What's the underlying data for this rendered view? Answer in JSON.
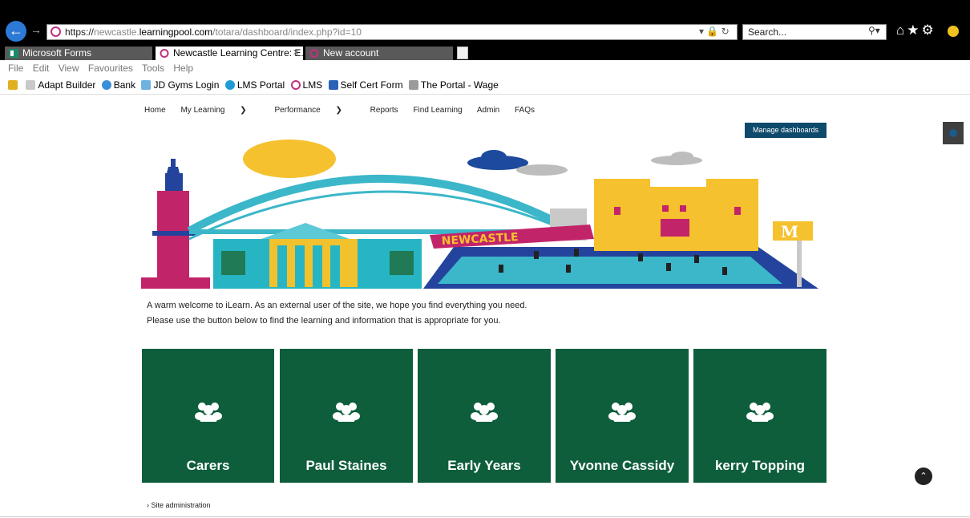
{
  "browser": {
    "url_proto": "https://",
    "url_domain_prefix": "newcastle.",
    "url_domain": "learningpool.com",
    "url_path": "/totara/dashboard/index.php?id=10",
    "search_placeholder": "Search...",
    "tabs": [
      {
        "label": "Microsoft Forms"
      },
      {
        "label": "Newcastle Learning Centre: E..."
      },
      {
        "label": "New account"
      }
    ],
    "menu": [
      "File",
      "Edit",
      "View",
      "Favourites",
      "Tools",
      "Help"
    ],
    "favourites": [
      {
        "label": "Adapt Builder",
        "color": "#c9c9c9"
      },
      {
        "label": "Bank",
        "color": "#3b8fd9"
      },
      {
        "label": "JD Gyms Login",
        "color": "#6fb1e0"
      },
      {
        "label": "LMS Portal",
        "color": "#1f9bd7"
      },
      {
        "label": "LMS",
        "color": "#c0317f"
      },
      {
        "label": "Self Cert Form",
        "color": "#2a62b8"
      },
      {
        "label": "The Portal - Wage",
        "color": "#9a9a9a"
      }
    ]
  },
  "page": {
    "nav": {
      "home": "Home",
      "my_learning": "My Learning",
      "performance": "Performance",
      "reports": "Reports",
      "find_learning": "Find Learning",
      "admin": "Admin",
      "faqs": "FAQs"
    },
    "manage_dashboards": "Manage dashboards",
    "banner_text": "NEWCASTLE",
    "welcome_line1": "A warm welcome to iLearn.  As an external user of the site, we hope you find everything you need.",
    "welcome_line2": "Please use the button below to find the learning and information that is appropriate for you.",
    "tiles": [
      {
        "label": "Carers"
      },
      {
        "label": "Paul Staines"
      },
      {
        "label": "Early Years"
      },
      {
        "label": "Yvonne Cassidy"
      },
      {
        "label": "kerry Topping"
      }
    ],
    "site_admin": "› Site administration",
    "tile_color": "#0e5e3c",
    "accent": "#0e4a6b"
  }
}
